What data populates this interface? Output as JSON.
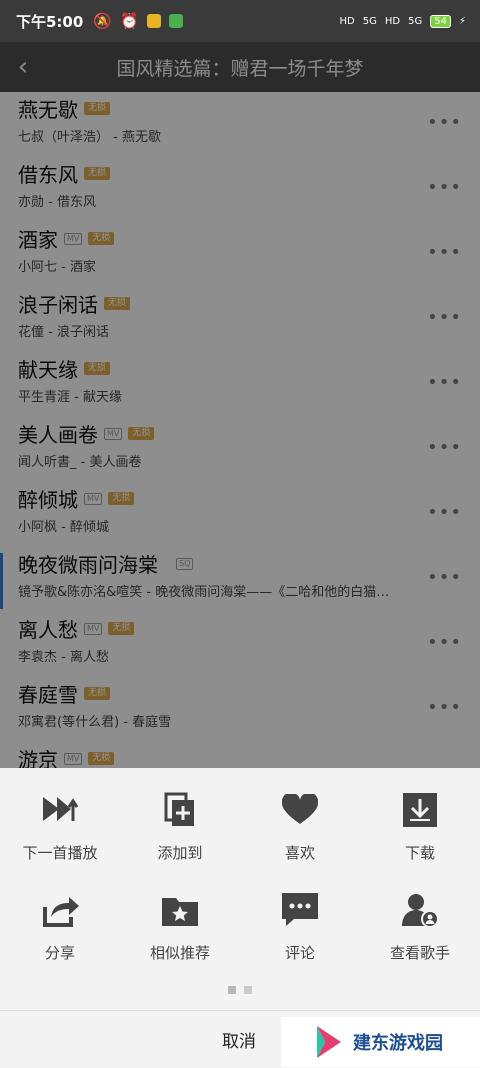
{
  "status_bar": {
    "time": "下午5:00",
    "signal1": "5G",
    "signal2": "5G",
    "battery": "54"
  },
  "header": {
    "title": "国风精选篇：赠君一场千年梦"
  },
  "badges": {
    "mv": "MV",
    "quality": "SQ",
    "vip": "无损"
  },
  "songs": [
    {
      "name": "燕无歇",
      "artist": "七叔（叶泽浩） - 燕无歇",
      "mv": false,
      "vip": true
    },
    {
      "name": "借东风",
      "artist": "亦勋 - 借东风",
      "mv": false,
      "vip": true
    },
    {
      "name": "酒家",
      "artist": "小阿七 - 酒家",
      "mv": true,
      "vip": true
    },
    {
      "name": "浪子闲话",
      "artist": "花僮 - 浪子闲话",
      "mv": false,
      "vip": true
    },
    {
      "name": "献天缘",
      "artist": "平生青涯 - 献天缘",
      "mv": false,
      "vip": true
    },
    {
      "name": "美人画卷",
      "artist": "闻人听書_ - 美人画卷",
      "mv": true,
      "vip": true
    },
    {
      "name": "醉倾城",
      "artist": "小阿枫 - 醉倾城",
      "mv": true,
      "vip": true
    },
    {
      "name": "晚夜微雨问海棠",
      "artist": "镜予歌&陈亦洺&喧笑 - 晚夜微雨问海棠——《二哈和他的白猫…",
      "mv": false,
      "vip": false,
      "sq": true,
      "current": true
    },
    {
      "name": "离人愁",
      "artist": "李袁杰 - 离人愁",
      "mv": true,
      "vip": true
    },
    {
      "name": "春庭雪",
      "artist": "邓寓君(等什么君) - 春庭雪",
      "mv": false,
      "vip": true
    },
    {
      "name": "游京",
      "artist": "",
      "mv": true,
      "vip": true
    }
  ],
  "sheet": {
    "actions": [
      {
        "label": "下一首播放",
        "icon": "play-next-icon"
      },
      {
        "label": "添加到",
        "icon": "add-to-playlist-icon"
      },
      {
        "label": "喜欢",
        "icon": "heart-icon"
      },
      {
        "label": "下载",
        "icon": "download-icon"
      },
      {
        "label": "分享",
        "icon": "share-icon"
      },
      {
        "label": "相似推荐",
        "icon": "similar-folder-icon"
      },
      {
        "label": "评论",
        "icon": "comment-icon"
      },
      {
        "label": "查看歌手",
        "icon": "singer-icon"
      }
    ],
    "cancel": "取消"
  },
  "watermark": {
    "text": "建东游戏园"
  }
}
